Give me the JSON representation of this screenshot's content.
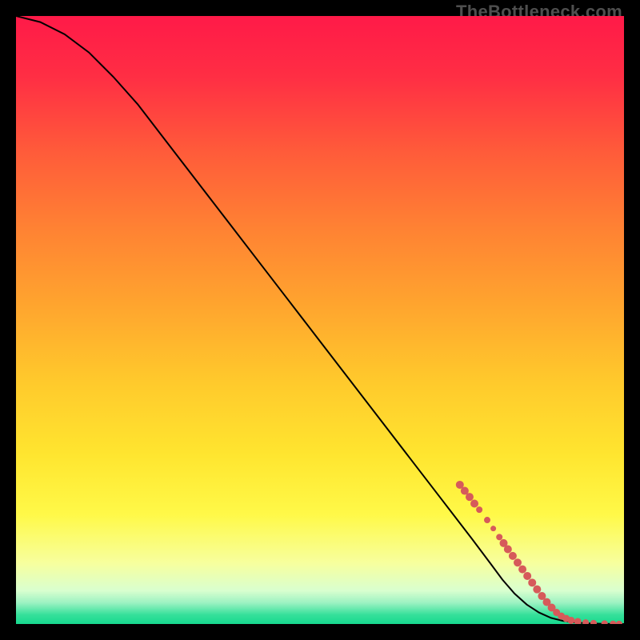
{
  "watermark": "TheBottleneck.com",
  "gradient_stops": [
    {
      "offset": 0.0,
      "color": "#ff1a48"
    },
    {
      "offset": 0.1,
      "color": "#ff2e44"
    },
    {
      "offset": 0.22,
      "color": "#ff5a3a"
    },
    {
      "offset": 0.35,
      "color": "#ff8233"
    },
    {
      "offset": 0.48,
      "color": "#ffa62e"
    },
    {
      "offset": 0.6,
      "color": "#ffc92c"
    },
    {
      "offset": 0.72,
      "color": "#ffe52f"
    },
    {
      "offset": 0.82,
      "color": "#fff948"
    },
    {
      "offset": 0.9,
      "color": "#f7ff9e"
    },
    {
      "offset": 0.945,
      "color": "#d9ffcf"
    },
    {
      "offset": 0.965,
      "color": "#9cf2c2"
    },
    {
      "offset": 0.985,
      "color": "#35e09a"
    },
    {
      "offset": 1.0,
      "color": "#17d98f"
    }
  ],
  "marker_color": "#d65a5a",
  "curve_color": "#000000",
  "chart_data": {
    "type": "line",
    "title": "",
    "xlabel": "",
    "ylabel": "",
    "xlim": [
      0,
      100
    ],
    "ylim": [
      0,
      100
    ],
    "series": [
      {
        "name": "curve",
        "x": [
          0,
          4,
          8,
          12,
          16,
          20,
          25,
          30,
          35,
          40,
          45,
          50,
          55,
          60,
          65,
          70,
          75,
          78,
          80,
          82,
          84,
          86,
          88,
          90,
          92,
          94,
          96,
          98,
          100
        ],
        "y": [
          100,
          99,
          97,
          94,
          90,
          85.5,
          79,
          72.5,
          66,
          59.5,
          53,
          46.5,
          40,
          33.5,
          27,
          20.5,
          14,
          10,
          7.3,
          5.0,
          3.2,
          1.9,
          1.0,
          0.5,
          0.25,
          0.12,
          0.05,
          0.02,
          0.0
        ]
      }
    ],
    "markers": [
      {
        "x": 73.0,
        "y": 22.9,
        "r": 5
      },
      {
        "x": 73.8,
        "y": 21.9,
        "r": 5
      },
      {
        "x": 74.6,
        "y": 20.9,
        "r": 5
      },
      {
        "x": 75.4,
        "y": 19.8,
        "r": 5
      },
      {
        "x": 76.2,
        "y": 18.8,
        "r": 4
      },
      {
        "x": 77.5,
        "y": 17.1,
        "r": 4
      },
      {
        "x": 78.5,
        "y": 15.7,
        "r": 3.5
      },
      {
        "x": 79.5,
        "y": 14.3,
        "r": 4
      },
      {
        "x": 80.2,
        "y": 13.3,
        "r": 5
      },
      {
        "x": 80.9,
        "y": 12.3,
        "r": 5
      },
      {
        "x": 81.7,
        "y": 11.2,
        "r": 5
      },
      {
        "x": 82.5,
        "y": 10.1,
        "r": 5
      },
      {
        "x": 83.3,
        "y": 9.0,
        "r": 5
      },
      {
        "x": 84.1,
        "y": 7.9,
        "r": 5
      },
      {
        "x": 84.9,
        "y": 6.8,
        "r": 5
      },
      {
        "x": 85.7,
        "y": 5.7,
        "r": 5
      },
      {
        "x": 86.5,
        "y": 4.6,
        "r": 5
      },
      {
        "x": 87.3,
        "y": 3.6,
        "r": 5
      },
      {
        "x": 88.1,
        "y": 2.7,
        "r": 5
      },
      {
        "x": 88.9,
        "y": 1.9,
        "r": 4.5
      },
      {
        "x": 89.7,
        "y": 1.3,
        "r": 4.5
      },
      {
        "x": 90.5,
        "y": 0.9,
        "r": 4.5
      },
      {
        "x": 91.3,
        "y": 0.6,
        "r": 4.5
      },
      {
        "x": 92.4,
        "y": 0.4,
        "r": 4.5
      },
      {
        "x": 93.7,
        "y": 0.25,
        "r": 4
      },
      {
        "x": 95.0,
        "y": 0.15,
        "r": 4
      },
      {
        "x": 96.8,
        "y": 0.08,
        "r": 4
      },
      {
        "x": 98.2,
        "y": 0.04,
        "r": 4
      },
      {
        "x": 99.2,
        "y": 0.02,
        "r": 4
      }
    ]
  }
}
